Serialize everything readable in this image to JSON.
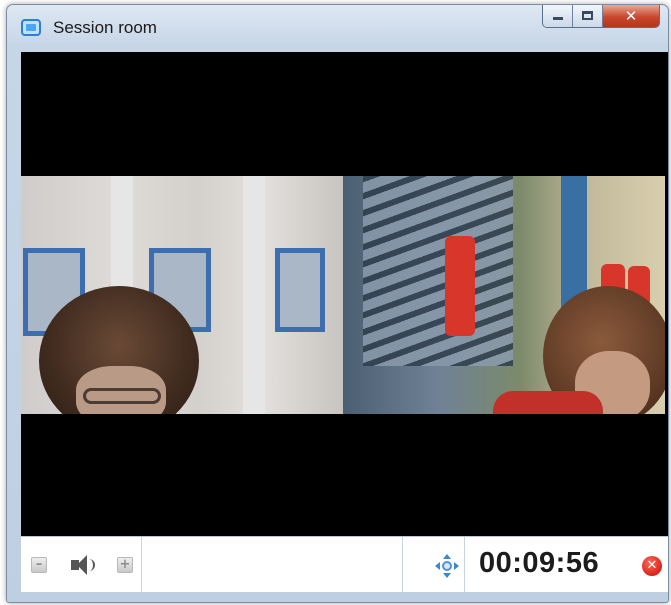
{
  "window": {
    "title": "Session room",
    "controls": {
      "minimize": "–",
      "maximize": "□",
      "close": "✕"
    }
  },
  "toolbar": {
    "volume_down_symbol": "–",
    "volume_up_symbol": "+",
    "timer": "00:09:56",
    "end_call_symbol": "✕"
  },
  "icons": {
    "app": "session-room-icon",
    "volume_down": "minus-icon",
    "speaker": "speaker-icon",
    "volume_up": "plus-icon",
    "move": "move-arrows-icon",
    "end_call": "close-circle-icon"
  },
  "colors": {
    "close_button": "#c8462c",
    "end_call": "#d8231a",
    "accent_blue": "#3b87d1"
  }
}
